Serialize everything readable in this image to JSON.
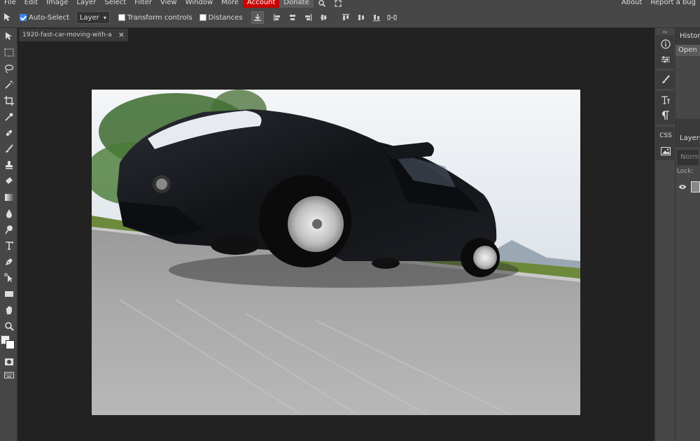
{
  "menu": {
    "items": [
      "File",
      "Edit",
      "Image",
      "Layer",
      "Select",
      "Filter",
      "View",
      "Window",
      "More"
    ],
    "account": "Account",
    "donate": "Donate",
    "right_items": [
      "About",
      "Report a bug"
    ]
  },
  "options": {
    "auto_select_label": "Auto-Select",
    "auto_select_checked": true,
    "select_value": "Layer",
    "transform_label": "Transform controls",
    "distances_label": "Distances"
  },
  "document": {
    "tab_title": "1920-fast-car-moving-with-a",
    "close": "×"
  },
  "panels": {
    "history_title": "History",
    "history_items": [
      "Open"
    ],
    "layers_title": "Layers",
    "blend_mode": "Normal",
    "lock_label": "Lock:"
  },
  "rightbar": {
    "css_label": "CSS"
  },
  "colors": {
    "accent": "#cc0000",
    "panel_bg": "#474747",
    "workspace_bg": "#222222"
  }
}
